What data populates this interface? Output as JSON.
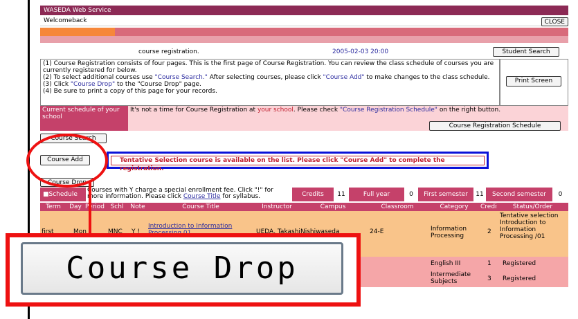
{
  "header": {
    "title": "WASEDA Web Service",
    "welcome": "Welcomeback",
    "close_label": "CLOSE"
  },
  "info": {
    "course_registration": "course registration.",
    "date": "2005-02-03 20:00",
    "student_search_label": "Student Search",
    "print_screen_label": "Print Screen"
  },
  "instructions": {
    "line1": "(1) Course Registration consists of four pages. This is the first page of Course Registration. You can review the class schedule of courses you are currently registered for below.",
    "line2_a": "(2) To select additional courses use ",
    "line2_link1": "\"Course Search.\"",
    "line2_b": " After selecting courses, please click ",
    "line2_link2": "\"Course Add\"",
    "line2_c": " to make changes to the class schedule.",
    "line3_a": "(3) Click ",
    "line3_link": "\"Course Drop\"",
    "line3_b": " to the \"Course Drop\" page.",
    "line4": "(4) Be sure to print a copy of this page for your records."
  },
  "current": {
    "label": "Current schedule of your school",
    "msg_a": "It's not a time for Course Registration at ",
    "msg_red": "your school",
    "msg_b": ". Please check ",
    "msg_link": "\"Course Registration Schedule\"",
    "msg_c": " on the right button.",
    "schedule_button": "Course Registration Schedule"
  },
  "buttons": {
    "course_search": "Course Search",
    "course_add": "Course Add",
    "course_drop": "Course Drop"
  },
  "tentative_message": "Tentative Selection course is available on the list. Please click \"Course Add\" to complete the registration.",
  "legend": {
    "schedule_label": "■Schedule",
    "note_a": "Courses with Y charge a special enrollment fee. Click \"!\" for more information. Please click ",
    "note_link": "Course Title",
    "note_b": " for syllabus.",
    "credits_label": "Credits",
    "credits_value": "11",
    "full_year_label": "Full year",
    "full_year_value": "0",
    "first_sem_label": "First semester",
    "first_sem_value": "11",
    "second_sem_label": "Second semester",
    "second_sem_value": "0"
  },
  "table": {
    "headers": [
      "Term",
      "Day",
      "Period",
      "Schl",
      "Note",
      "Course Title",
      "Instructor",
      "Campus",
      "Classroom",
      "Category",
      "Credit",
      "Status/Order"
    ],
    "rows": [
      {
        "term": "first",
        "day": "Mon",
        "schl": "MNC",
        "note": "Y !",
        "title": "Introduction to Information Processing 01",
        "instructor": "UEDA, Takashi",
        "campus": "Nishiwaseda",
        "classroom": "24-E",
        "category": "Information Processing",
        "credit": "2",
        "status": "Tentative selection Introduction to Information Processing /01"
      },
      {
        "category": "English III",
        "credit": "1",
        "status": "Registered"
      },
      {
        "category": "Intermediate Subjects",
        "credit": "3",
        "status": "Registered"
      }
    ]
  },
  "callout": {
    "zoom_label": "Course Drop"
  }
}
